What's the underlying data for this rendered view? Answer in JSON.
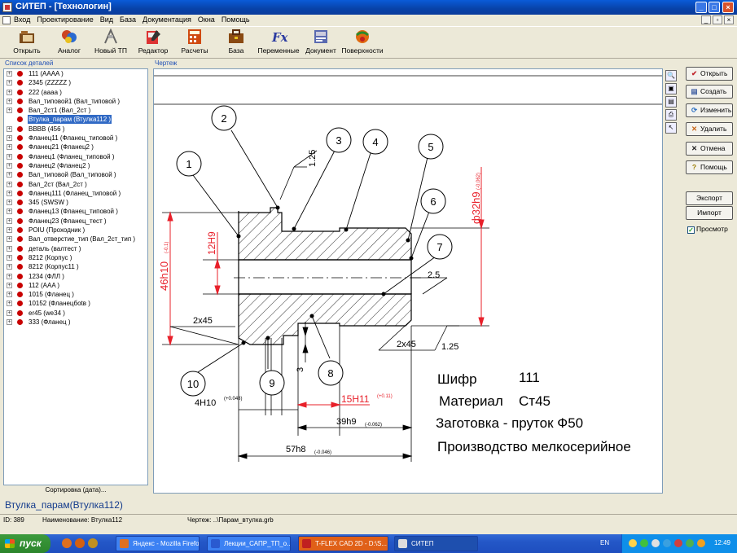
{
  "window": {
    "title": "СИТЕП - [Технологин]",
    "min": "_",
    "max": "□",
    "close": "×"
  },
  "menu": [
    "Вход",
    "Проектирование",
    "Вид",
    "База",
    "Документация",
    "Окна",
    "Помощь"
  ],
  "mdi_buttons": [
    "_",
    "▫",
    "×"
  ],
  "toolbar": [
    {
      "label": "Открыть",
      "icon": "open-folder-icon"
    },
    {
      "label": "Аналог",
      "icon": "analog-icon"
    },
    {
      "label": "Новый ТП",
      "icon": "new-process-icon"
    },
    {
      "label": "Редактор",
      "icon": "editor-icon"
    },
    {
      "label": "Расчеты",
      "icon": "calculator-icon"
    },
    {
      "label": "База",
      "icon": "database-icon"
    },
    {
      "label": "Переменные",
      "icon": "variables-fx-icon"
    },
    {
      "label": "Документ",
      "icon": "document-icon"
    },
    {
      "label": "Поверхности",
      "icon": "surfaces-icon"
    }
  ],
  "left_panel": {
    "caption": "Список деталей",
    "items": [
      {
        "label": "111 (AAAA )",
        "expander": "+"
      },
      {
        "label": "2345 (ZZZZZ )",
        "expander": "+"
      },
      {
        "label": "222 (aaaa )",
        "expander": "+"
      },
      {
        "label": "Вал_типовой1 (Вал_типовой )",
        "expander": "+"
      },
      {
        "label": "Вал_2ст1 (Вал_2ст )",
        "expander": "+"
      },
      {
        "label": "Втулка_парам (Втулка112 )",
        "expander": "",
        "selected": true
      },
      {
        "label": "BBBB (456 )",
        "expander": "+"
      },
      {
        "label": "Фланец11 (Фланец_типовой )",
        "expander": "+"
      },
      {
        "label": "Фланец21 (Фланец2 )",
        "expander": "+"
      },
      {
        "label": "Фланец1 (Фланец_типовой )",
        "expander": "+"
      },
      {
        "label": "Фланец2 (Фланец2 )",
        "expander": "+"
      },
      {
        "label": "Вал_типовой (Вал_типовой )",
        "expander": "+"
      },
      {
        "label": "Вал_2ст (Вал_2ст )",
        "expander": "+"
      },
      {
        "label": "Фланец111 (Фланец_типовой )",
        "expander": "+"
      },
      {
        "label": "345 (SWSW )",
        "expander": "+"
      },
      {
        "label": "Фланец13 (Фланец_типовой )",
        "expander": "+"
      },
      {
        "label": "Фланец23 (Фланец_тест )",
        "expander": "+"
      },
      {
        "label": "POIU (Проходник )",
        "expander": "+"
      },
      {
        "label": "Вал_отверстие_тип (Вал_2ст_тип )",
        "expander": "+"
      },
      {
        "label": "деталь (валтест )",
        "expander": "+"
      },
      {
        "label": "8212 (Корпус )",
        "expander": "+"
      },
      {
        "label": "8212 (Корпус11 )",
        "expander": "+"
      },
      {
        "label": "1234 (ФЛЛ )",
        "expander": "+"
      },
      {
        "label": "112 (AAA )",
        "expander": "+"
      },
      {
        "label": "1015 (Фланец )",
        "expander": "+"
      },
      {
        "label": "10152 (Фланецбоtв )",
        "expander": "+"
      },
      {
        "label": "er45 (we34 )",
        "expander": "+"
      },
      {
        "label": "333 (Фланец )",
        "expander": "+"
      }
    ],
    "sort_button": "Сортировка (дата)..."
  },
  "drawing": {
    "caption": "Чертеж",
    "balloons": [
      "1",
      "2",
      "3",
      "4",
      "5",
      "6",
      "7",
      "8",
      "9",
      "10"
    ],
    "dims": {
      "d46": "46h10",
      "d46tol": "(-0.1)",
      "d12": "12H9",
      "d32": "ф32h9",
      "d32tol": "(-0.062)",
      "r125a": "1.25",
      "r125b": "1.25",
      "d25": "2.5",
      "c45a": "2x45",
      "c45b": "2x45",
      "d3": "3",
      "w4": "4H10",
      "w4tol": "(+0.048)",
      "w15": "15H11",
      "w15tol": "(+0.11)",
      "w39": "39h9",
      "w39tol": "(-0.062)",
      "w57": "57h8",
      "w57tol": "(-0.046)"
    },
    "info": {
      "cipher_label": "Шифр",
      "cipher_value": "111",
      "material_label": "Материал",
      "material_value": "Ст45",
      "blank": "Заготовка - пруток Ф50",
      "production": "Производство мелкосерийное"
    },
    "side_tools": [
      "zoom-icon",
      "fit-icon",
      "printer-icon",
      "print-preview-icon",
      "pointer-icon"
    ]
  },
  "right_buttons": [
    {
      "label": "Открыть",
      "icon": "✔",
      "color": "#c0262d"
    },
    {
      "label": "Создать",
      "icon": "▤",
      "color": "#3a5aa0"
    },
    {
      "label": "Изменить",
      "icon": "⟳",
      "color": "#2a6ec2"
    },
    {
      "label": "Удалить",
      "icon": "✕",
      "color": "#c86414"
    },
    {
      "label": "Отмена",
      "icon": "✕",
      "color": "#222222"
    },
    {
      "label": "Помощь",
      "icon": "?",
      "color": "#9a7b00"
    }
  ],
  "export_button": "Экспорт",
  "import_button": "Импорт",
  "preview": {
    "label": "Просмотр",
    "checked": true,
    "mark": "✓"
  },
  "selected_name": "Втулка_парам(Втулка112)",
  "status": {
    "id": "ID: 389",
    "name": "Наименование: Втулка112",
    "drawing": "Чертеж: ..\\Парам_втулка.grb"
  },
  "taskbar": {
    "start": "пуск",
    "tasks": [
      {
        "label": "Яндекс - Mozilla Firefox",
        "active": false
      },
      {
        "label": "Лекции_САПР_ТП_о...",
        "active": false
      },
      {
        "label": "T-FLEX CAD 2D - D:\\S...",
        "active": false
      },
      {
        "label": "СИТЕП",
        "active": true
      }
    ],
    "lang": "EN",
    "time": "12:49"
  },
  "colors": {
    "dim_red": "#e8202a",
    "title_blue": "#0842a8",
    "selection": "#316ac5",
    "bullet_red": "#c80000"
  }
}
